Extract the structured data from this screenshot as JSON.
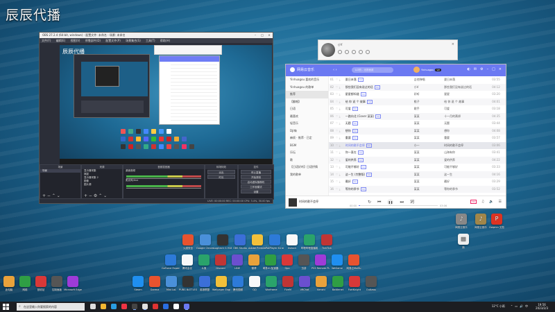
{
  "watermark": "辰辰代播",
  "obs": {
    "title": "OBS 27.2.4 (64-bit, windows) - 配置文件: 未命名 - 场景: 未命名",
    "menu": [
      "文件(F)",
      "编辑(E)",
      "视图(V)",
      "停靠部件(D)",
      "配置文件(P)",
      "场景集合(S)",
      "工具(T)",
      "帮助(H)"
    ],
    "preview_watermark": "辰辰代播",
    "scenes_header": "场景",
    "scenes": [
      "场景"
    ],
    "sources_header": "来源",
    "sources": [
      "显示器采集",
      "捕捉",
      "显示器采集 2",
      "图像",
      "图片源"
    ],
    "mixer_header": "音频混音器",
    "mixer": [
      "桌面音频",
      "麦克风/Aux"
    ],
    "transitions_header": "转场特效",
    "transitions": [
      "淡出",
      "时长"
    ],
    "controls_header": "控件",
    "controls": [
      "停止直播",
      "开始录制",
      "启动虚拟摄像机",
      "工作室模式",
      "设置",
      "退出"
    ],
    "status": "LIVE: 00:00:00  REC: 00:00:00  CPU: 3.4%, 30.00 fps"
  },
  "chat": {
    "name": "小Y"
  },
  "music": {
    "logo": "网易云音乐",
    "search_placeholder": "LLT的 - 无损音质",
    "username": "Yinhuagou",
    "vip": "VIP",
    "sidebar": [
      "Yinhuagou 喜欢的音乐",
      "Yinhuagou 的歌单",
      "推荐",
      "【翻唱】",
      "日语",
      "最喜欢",
      "轻音乐",
      "DJ/嗨",
      "麻烦 · 推荐 · 已定",
      "BGM",
      "乐坛",
      "歌",
      "【日语好听】日语抒情",
      "我的歌单"
    ],
    "songs": [
      {
        "n": "01",
        "title": "夏日未落",
        "tag": "SQ",
        "artist": "吉他弹唱",
        "album": "夏日未落",
        "dur": "03:55"
      },
      {
        "n": "02",
        "title": "那些我们没有说过的话",
        "tag": "SQ",
        "artist": "小V",
        "album": "那些我们没有说过的话",
        "dur": "04:12"
      },
      {
        "n": "03",
        "title": "星星都知道",
        "tag": "SQ",
        "artist": "好听",
        "album": "星星",
        "dur": "03:20"
      },
      {
        "n": "04",
        "title": "给 你 说 个 故事",
        "tag": "SQ",
        "artist": "桃子",
        "album": "给 你 说 个 故事",
        "dur": "04:01"
      },
      {
        "n": "05",
        "title": "可爱",
        "tag": "SQ",
        "artist": "歌手",
        "album": "可爱",
        "dur": "03:18"
      },
      {
        "n": "06",
        "title": "一路向北 (Cover 某某)",
        "tag": "SQ",
        "artist": "某某",
        "album": "十一月的萧邦",
        "dur": "04:35"
      },
      {
        "n": "07",
        "title": "无题",
        "tag": "SQ",
        "artist": "某某",
        "album": "无题",
        "dur": "03:44"
      },
      {
        "n": "08",
        "title": "想你",
        "tag": "SQ",
        "artist": "某某",
        "album": "想你",
        "dur": "04:08"
      },
      {
        "n": "09",
        "title": "重要",
        "tag": "SQ",
        "artist": "某某",
        "album": "重要",
        "dur": "03:57"
      },
      {
        "n": "10",
        "title": "时间的歌不会停",
        "tag": "SQ",
        "artist": "小一",
        "album": "时间的歌不会停",
        "dur": "03:06"
      },
      {
        "n": "11",
        "title": "你一直在",
        "tag": "SQ",
        "artist": "某某",
        "album": "山海有你",
        "dur": "03:41"
      },
      {
        "n": "12",
        "title": "爱的供养",
        "tag": "SQ",
        "artist": "某某",
        "album": "爱的供养",
        "dur": "04:22"
      },
      {
        "n": "13",
        "title": "可能不够好",
        "tag": "SQ",
        "artist": "某某",
        "album": "可能不够好",
        "dur": "03:33"
      },
      {
        "n": "14",
        "title": "这一生 (完整版)",
        "tag": "SQ",
        "artist": "某某",
        "album": "这一生",
        "dur": "04:16"
      },
      {
        "n": "15",
        "title": "最好",
        "tag": "SQ",
        "artist": "某某",
        "album": "最好",
        "dur": "03:29"
      },
      {
        "n": "16",
        "title": "等你的季节",
        "tag": "SQ",
        "artist": "某某",
        "album": "等你的季节",
        "dur": "03:52"
      }
    ],
    "playing_index": 9,
    "player": {
      "song": "时间的歌不会停",
      "elapsed": "00:00",
      "total": "03:06",
      "progress": 0.02,
      "quality": "HD"
    }
  },
  "desktop_icons_right": [
    "网易云音乐",
    "网易云音乐",
    "Dolphin 文档",
    "新"
  ],
  "desktop_icons_row1": [
    "火绒安全",
    "Google Chrome",
    "Logitech G HUB",
    "OBS Studio",
    "Adobe Premiere",
    "PotPlayer 64 bit",
    "Xshock",
    "哔哩哔哩直播姬",
    "TickTick"
  ],
  "desktop_icons_row2": [
    "GeForce Experience",
    "腾讯会议",
    "斗鱼",
    "Discord",
    "LINE",
    "微博",
    "网易UU加速器",
    "Gpo",
    "迅游",
    "PS5 Remote Play",
    "WeGame",
    "网易云MuMu"
  ],
  "desktop_icons_row3": [
    "此电脑",
    "网络",
    "回收站",
    "控制面板",
    "Microsoft Edge",
    "Steam",
    "Garena",
    "Mini LoL",
    "PUBG BATTLEGROUNDS",
    "英雄联盟",
    "Wallpaper Engine",
    "腾讯视频",
    "QQ",
    "Warframe",
    "FiveM",
    "VRChat",
    "Kenshi",
    "Battlenet",
    "FortKnight",
    "Outlaws"
  ],
  "taskbar": {
    "search_placeholder": "在这里输入你要搜索的内容",
    "weather": "12°C 小雨",
    "time": "19:56",
    "date": "2023/2/3"
  },
  "colors": {
    "music_accent": "#6b79f2",
    "obs_bg": "#2b2e38",
    "taskbar": "#1c1e22"
  }
}
